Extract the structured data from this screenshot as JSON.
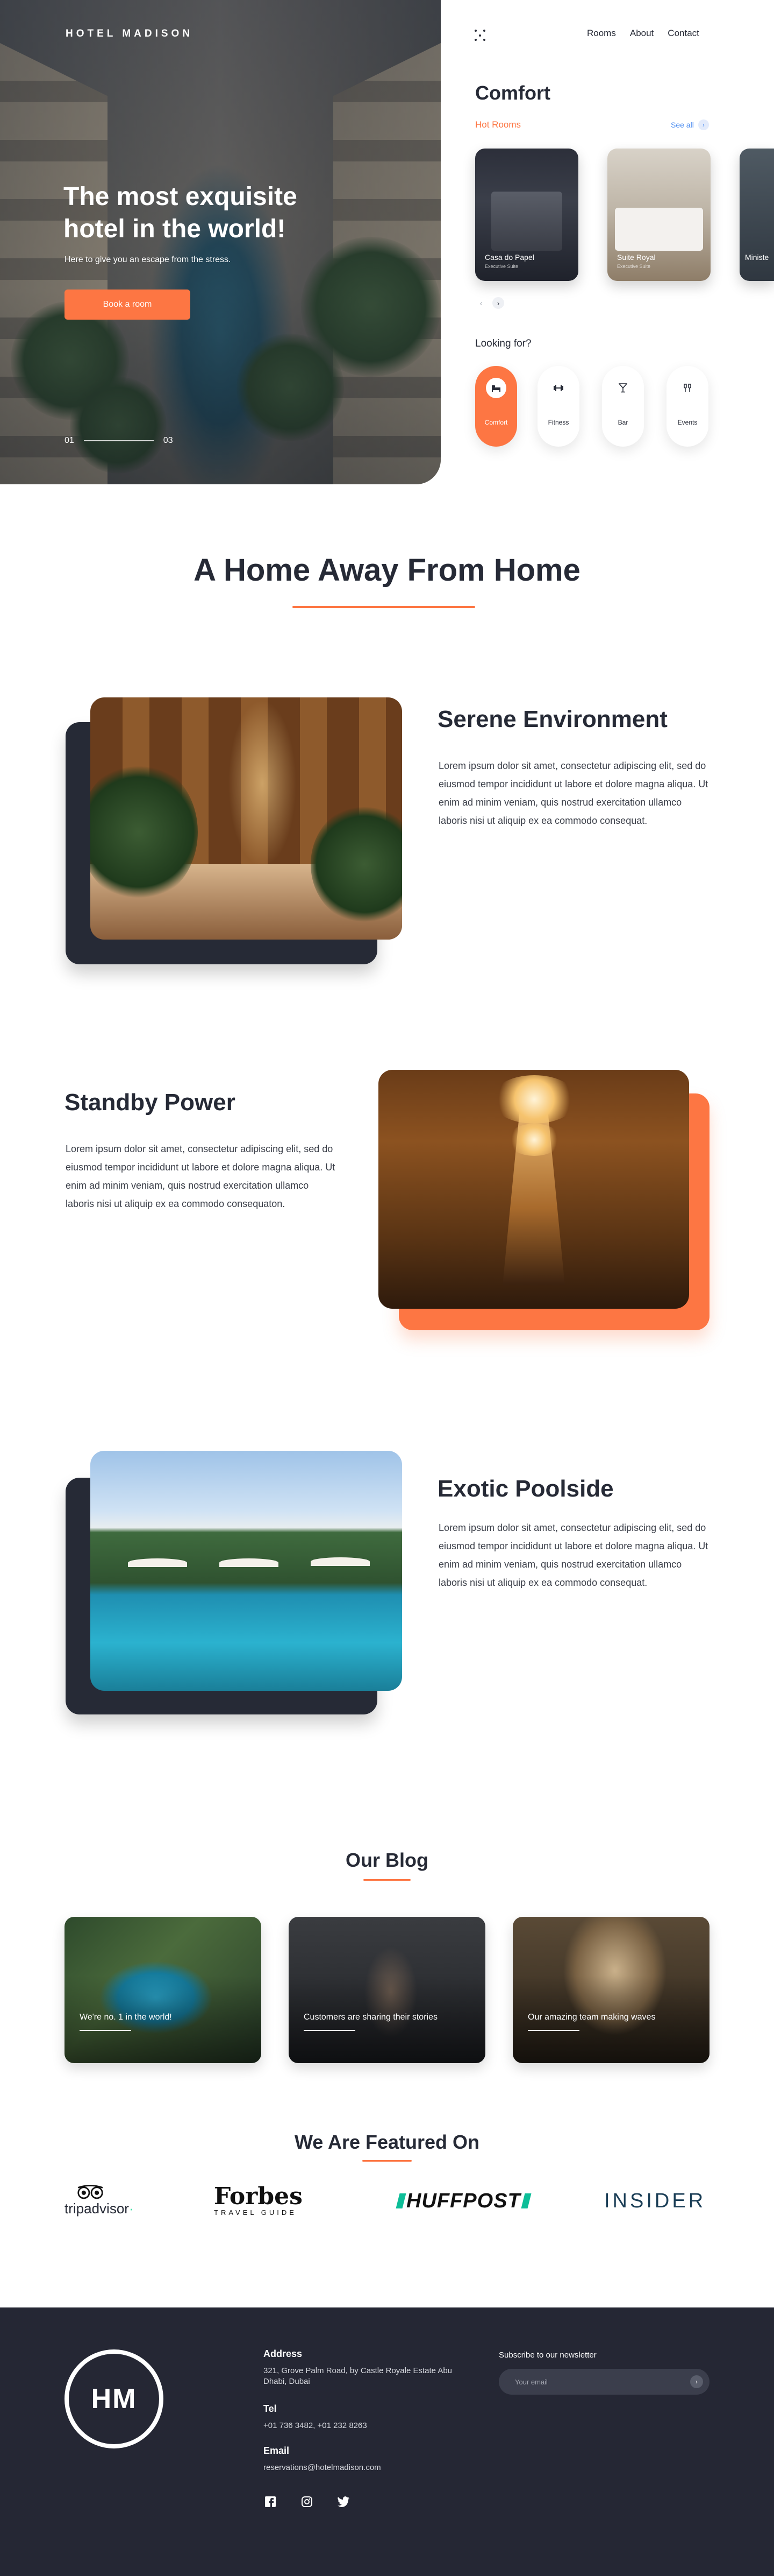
{
  "brand": "HOTEL MADISON",
  "hero": {
    "title": "The most exquisite hotel in the world!",
    "subtitle": "Here to give you an escape from the stress.",
    "cta": "Book a room",
    "slide_current": "01",
    "slide_total": "03"
  },
  "nav": {
    "items": [
      "Rooms",
      "About",
      "Contact"
    ]
  },
  "comfort": {
    "title": "Comfort",
    "hot_rooms": "Hot Rooms",
    "see_all": "See all",
    "rooms": [
      {
        "name": "Casa do Papel",
        "sub": "Executive Suite"
      },
      {
        "name": "Suite Royal",
        "sub": "Executive Suite"
      },
      {
        "name": "Ministe",
        "sub": ""
      }
    ],
    "looking_for": "Looking for?",
    "categories": [
      {
        "label": "Comfort",
        "icon": "bed-icon"
      },
      {
        "label": "Fitness",
        "icon": "dumbbell-icon"
      },
      {
        "label": "Bar",
        "icon": "cocktail-icon"
      },
      {
        "label": "Events",
        "icon": "cheers-icon"
      }
    ]
  },
  "section_home": {
    "title": "A Home Away From Home"
  },
  "features": [
    {
      "title": "Serene Environment",
      "text": "Lorem ipsum dolor sit amet, consectetur adipiscing elit, sed do eiusmod tempor incididunt ut labore et dolore magna aliqua. Ut enim ad minim veniam, quis nostrud exercitation ullamco laboris nisi ut aliquip ex ea commodo consequat."
    },
    {
      "title": "Standby Power",
      "text": "Lorem ipsum dolor sit amet, consectetur adipiscing elit, sed do eiusmod tempor incididunt ut labore et dolore magna aliqua. Ut enim ad minim veniam, quis nostrud exercitation ullamco laboris nisi ut aliquip ex ea commodo consequaton."
    },
    {
      "title": "Exotic Poolside",
      "text": "Lorem ipsum dolor sit amet, consectetur adipiscing elit, sed do eiusmod tempor incididunt ut labore et dolore magna aliqua. Ut enim ad minim veniam, quis nostrud exercitation ullamco laboris nisi ut aliquip ex ea commodo consequat."
    }
  ],
  "blog": {
    "title": "Our Blog",
    "posts": [
      "We're no. 1 in the world!",
      "Customers are sharing their stories",
      "Our amazing team making waves"
    ]
  },
  "featured": {
    "title": "We Are Featured On",
    "logos": [
      "tripadvisor",
      "Forbes",
      "TRAVEL GUIDE",
      "HUFFPOST",
      "INSIDER"
    ]
  },
  "footer": {
    "logo": "HM",
    "address_label": "Address",
    "address": "321, Grove Palm Road, by Castle Royale Estate Abu Dhabi, Dubai",
    "tel_label": "Tel",
    "tel": "+01 736 3482, +01 232 8263",
    "email_label": "Email",
    "email": "reservations@hotelmadison.com",
    "newsletter_label": "Subscribe to our newsletter",
    "newsletter_placeholder": "Your email"
  },
  "colors": {
    "accent": "#fd7643",
    "dark": "#252734",
    "text": "#262a36",
    "link": "#4b8cf0"
  }
}
